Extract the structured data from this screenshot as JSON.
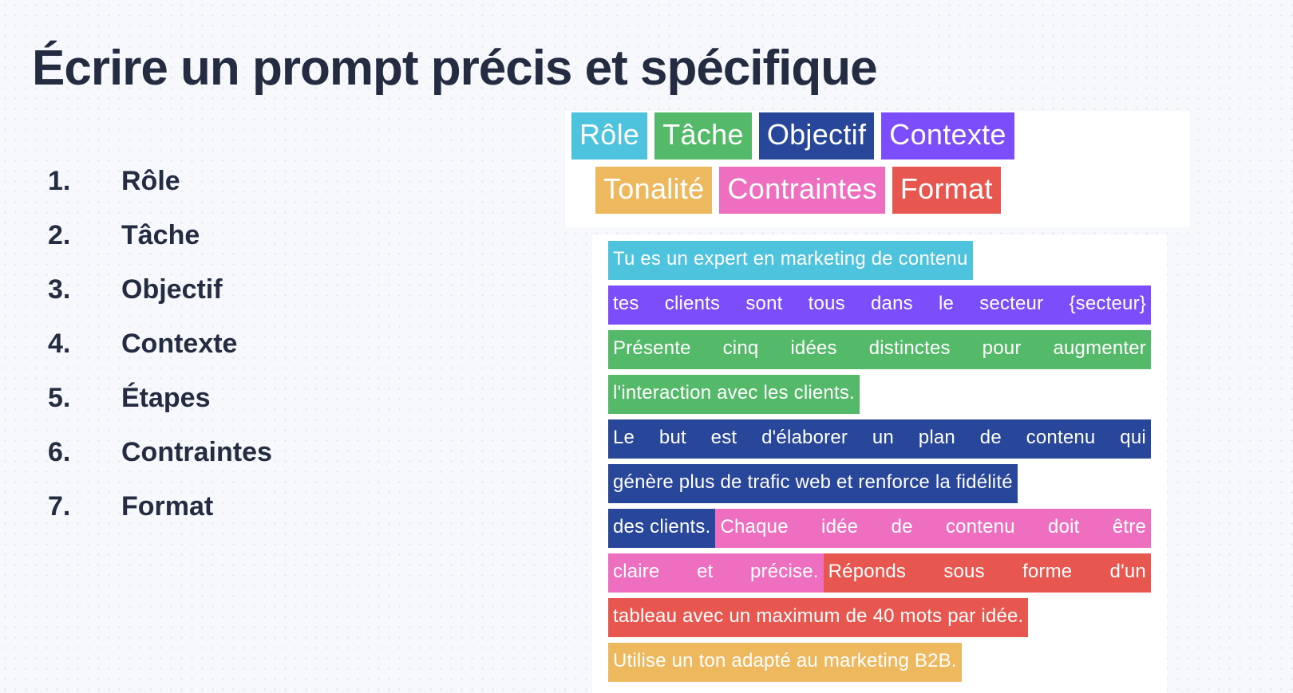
{
  "page": {
    "title": "Écrire un prompt précis et spécifique",
    "background_color": "#f6f8fc",
    "title_color": "#232c40"
  },
  "colors": {
    "role": "#4ec3dd",
    "tache": "#55b96a",
    "objectif": "#28469a",
    "contexte": "#7c4dfa",
    "tonalite": "#eeb85f",
    "contraintes": "#ee6fbf",
    "format": "#e8574f"
  },
  "steps": [
    {
      "num": "1.",
      "label": "Rôle"
    },
    {
      "num": "2.",
      "label": "Tâche"
    },
    {
      "num": "3.",
      "label": "Objectif"
    },
    {
      "num": "4.",
      "label": "Contexte"
    },
    {
      "num": "5.",
      "label": "Étapes"
    },
    {
      "num": "6.",
      "label": "Contraintes"
    },
    {
      "num": "7.",
      "label": "Format"
    }
  ],
  "legend": {
    "row1": [
      {
        "label": "Rôle",
        "color": "#4ec3dd"
      },
      {
        "label": "Tâche",
        "color": "#55b96a"
      },
      {
        "label": "Objectif",
        "color": "#28469a"
      },
      {
        "label": "Contexte",
        "color": "#7c4dfa"
      }
    ],
    "row2": [
      {
        "label": "Tonalité",
        "color": "#eeb85f"
      },
      {
        "label": "Contraintes",
        "color": "#ee6fbf"
      },
      {
        "label": "Format",
        "color": "#e8574f"
      }
    ]
  },
  "prompt": {
    "lines": [
      {
        "segments": [
          {
            "text": "Tu es un expert en marketing de contenu",
            "color": "#4ec3dd",
            "category": "role",
            "justify": false
          }
        ]
      },
      {
        "segments": [
          {
            "text": "tes clients sont tous dans le secteur {secteur}",
            "color": "#7c4dfa",
            "category": "contexte",
            "justify": true
          }
        ]
      },
      {
        "segments": [
          {
            "text": "Présente cinq idées distinctes pour augmenter",
            "color": "#55b96a",
            "category": "tache",
            "justify": true
          }
        ]
      },
      {
        "segments": [
          {
            "text": "l'interaction avec les clients.",
            "color": "#55b96a",
            "category": "tache",
            "justify": false
          }
        ]
      },
      {
        "segments": [
          {
            "text": "Le but est d'élaborer un plan de contenu qui",
            "color": "#28469a",
            "category": "objectif",
            "justify": true
          }
        ]
      },
      {
        "segments": [
          {
            "text": "génère plus de trafic web et renforce la fidélité",
            "color": "#28469a",
            "category": "objectif",
            "justify": false
          }
        ]
      },
      {
        "segments": [
          {
            "text": "des clients.",
            "color": "#28469a",
            "category": "objectif",
            "justify": false
          },
          {
            "text": "Chaque idée de contenu doit être",
            "color": "#ee6fbf",
            "category": "contraintes",
            "justify": true
          }
        ]
      },
      {
        "segments": [
          {
            "text": "claire et précise.",
            "color": "#ee6fbf",
            "category": "contraintes",
            "justify": true
          },
          {
            "text": "Réponds sous forme d'un",
            "color": "#e8574f",
            "category": "format",
            "justify": true
          }
        ]
      },
      {
        "segments": [
          {
            "text": "tableau avec un maximum de 40 mots par idée.",
            "color": "#e8574f",
            "category": "format",
            "justify": false
          }
        ]
      },
      {
        "segments": [
          {
            "text": "Utilise un ton adapté au marketing B2B.",
            "color": "#eeb85f",
            "category": "tonalite",
            "justify": false
          }
        ]
      }
    ]
  }
}
